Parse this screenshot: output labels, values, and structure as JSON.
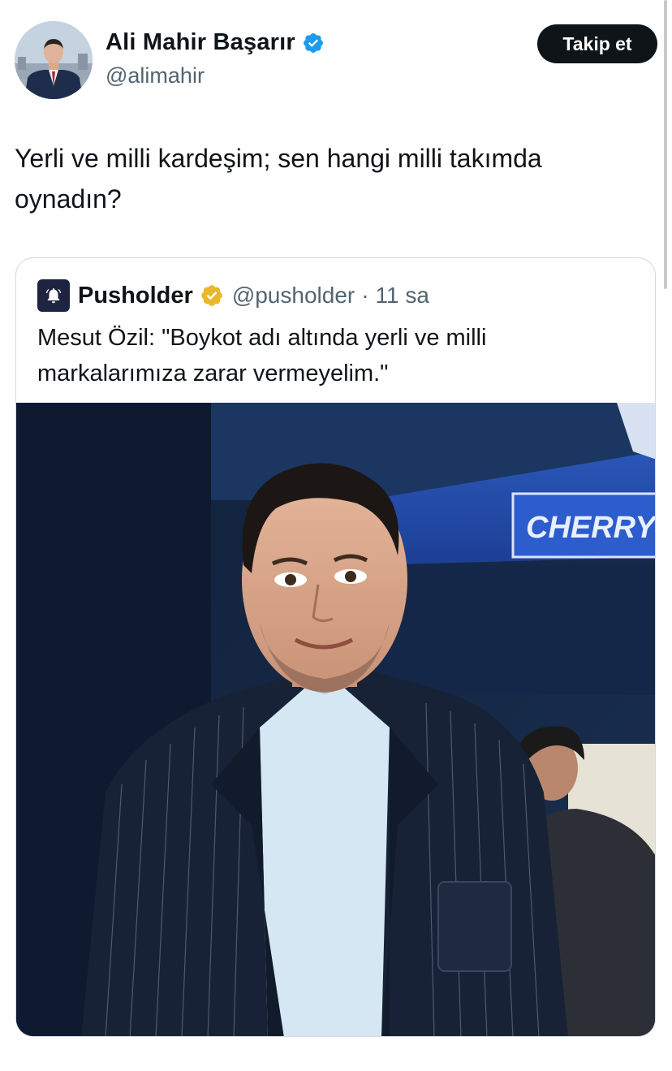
{
  "author": {
    "display_name": "Ali Mahir Başarır",
    "handle": "@alimahir",
    "follow_label": "Takip et"
  },
  "tweet": {
    "text": "Yerli ve milli kardeşim; sen hangi milli takımda oynadın?"
  },
  "quoted": {
    "display_name": "Pusholder",
    "handle": "@pusholder",
    "separator": "·",
    "time": "11 sa",
    "text": "Mesut Özil: \"Boykot adı altında yerli ve milli markalarımıza zarar vermeyelim.\"",
    "image_sign_text": "CHERRY"
  },
  "icons": {
    "verified": "verified-badge-icon",
    "verified_org": "gold-verified-badge-icon",
    "pusholder_logo": "bell-logo-icon"
  },
  "colors": {
    "verified_blue": "#1d9bf0",
    "verified_gold": "#e8b829",
    "text_primary": "#0f1419",
    "text_secondary": "#536471",
    "follow_button_bg": "#0f1419",
    "card_border": "#cfd9de"
  }
}
